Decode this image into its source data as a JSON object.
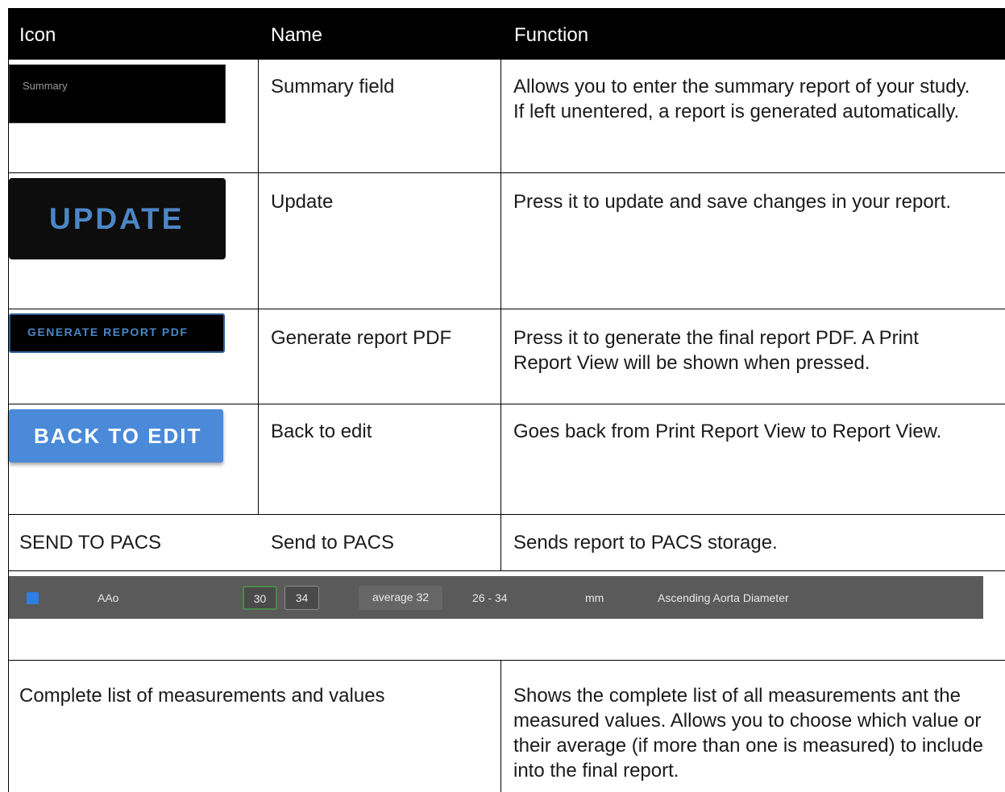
{
  "headers": {
    "icon": "Icon",
    "name": "Name",
    "function": "Function"
  },
  "rows": [
    {
      "icon_text": "Summary",
      "name": "Summary field",
      "function": "Allows you to enter the summary report of your study. If left unentered, a report is generated automatically."
    },
    {
      "icon_text": "UPDATE",
      "name": "Update",
      "function": "Press it to update and save changes in your report."
    },
    {
      "icon_text": "GENERATE REPORT PDF",
      "name": "Generate report PDF",
      "function": "Press it to generate the final report PDF. A Print Report View will be shown when pressed."
    },
    {
      "icon_text": "BACK TO EDIT",
      "name": "Back to edit",
      "function": "Goes back from Print Report View to Report View."
    },
    {
      "icon_text": "SEND TO PACS",
      "name": "Send to PACS",
      "function": "Sends report to PACS storage."
    }
  ],
  "measurement_strip": {
    "checked": true,
    "label": "AAo",
    "value_1": "30",
    "value_2": "34",
    "average": "average 32",
    "range": "26 - 34",
    "unit": "mm",
    "description": "Ascending Aorta Diameter"
  },
  "last_row": {
    "name": "Complete list of measurements and values",
    "function": "Shows the complete list of all measurements ant the measured values. Allows you to choose which value or their average (if more than one is measured) to include into the final report."
  },
  "colors": {
    "header_bg": "#000000",
    "button_blue": "#4a8ad8",
    "update_text": "#4c86c6",
    "strip_bg": "#5a5a5a",
    "checkbox": "#2e7fe0",
    "selected_value_border": "#4b8a4b"
  }
}
